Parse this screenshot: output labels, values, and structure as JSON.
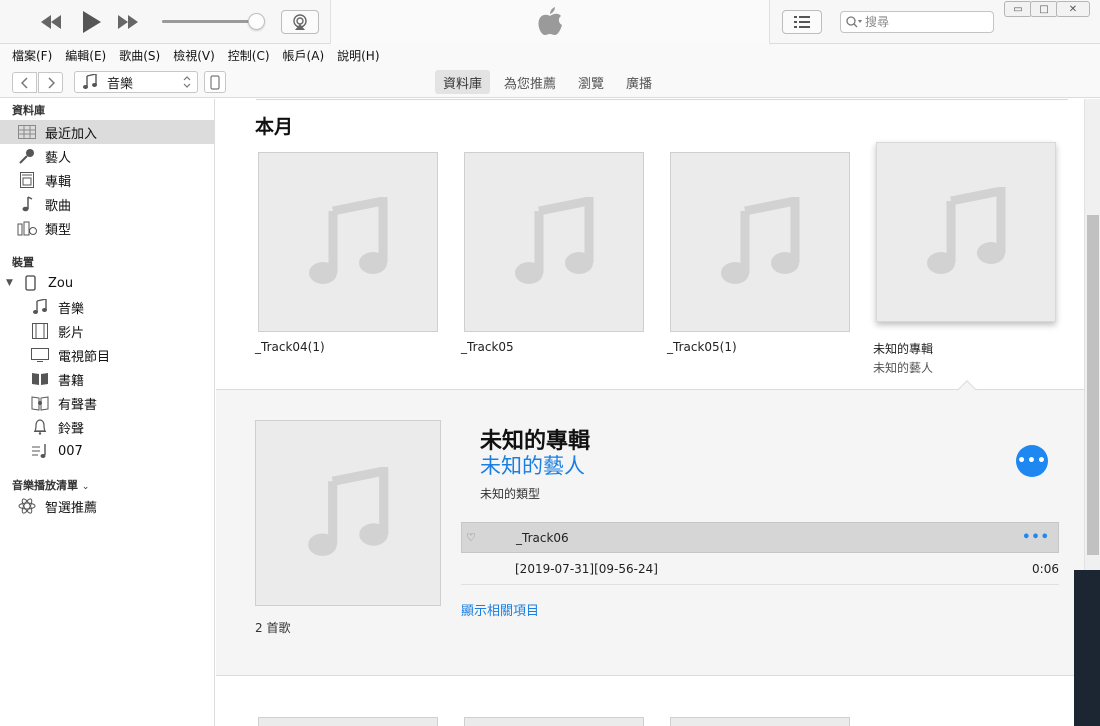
{
  "window": {
    "search_placeholder": "搜尋",
    "minimize_glyph": "▭",
    "restore_glyph": "□",
    "close_glyph": "✕"
  },
  "menu": [
    "檔案(F)",
    "編輯(E)",
    "歌曲(S)",
    "檢視(V)",
    "控制(C)",
    "帳戶(A)",
    "說明(H)"
  ],
  "nav": {
    "media_kind": "音樂",
    "tabs": [
      "資料庫",
      "為您推薦",
      "瀏覽",
      "廣播"
    ],
    "active_tab": "資料庫"
  },
  "sidebar": {
    "library_title": "資料庫",
    "library": [
      {
        "label": "最近加入",
        "icon": "grid-icon",
        "selected": true
      },
      {
        "label": "藝人",
        "icon": "microphone-icon"
      },
      {
        "label": "專輯",
        "icon": "album-icon"
      },
      {
        "label": "歌曲",
        "icon": "note-icon"
      },
      {
        "label": "類型",
        "icon": "genre-icon"
      }
    ],
    "devices_title": "裝置",
    "device_name": "Zou",
    "device_items": [
      {
        "label": "音樂",
        "icon": "music-icon"
      },
      {
        "label": "影片",
        "icon": "film-icon"
      },
      {
        "label": "電視節目",
        "icon": "tv-icon"
      },
      {
        "label": "書籍",
        "icon": "book-icon"
      },
      {
        "label": "有聲書",
        "icon": "audiobook-icon"
      },
      {
        "label": "鈴聲",
        "icon": "bell-icon"
      },
      {
        "label": "007",
        "icon": "playlist-icon"
      }
    ],
    "playlists_title": "音樂播放清單",
    "playlists": [
      {
        "label": "智選推薦",
        "icon": "genius-icon"
      }
    ]
  },
  "main": {
    "section_title": "本月",
    "albums": [
      {
        "title": "_Track04(1)",
        "artist": ""
      },
      {
        "title": "_Track05",
        "artist": ""
      },
      {
        "title": "_Track05(1)",
        "artist": ""
      },
      {
        "title": "未知的專輯",
        "artist": "未知的藝人"
      }
    ],
    "detail": {
      "album": "未知的專輯",
      "artist": "未知的藝人",
      "genre": "未知的類型",
      "tracks": [
        {
          "name": "_Track06",
          "duration": "",
          "selected": true
        },
        {
          "name": "[2019-07-31][09-56-24]",
          "duration": "0:06",
          "selected": false
        }
      ],
      "show_related": "顯示相關項目",
      "song_count": "2 首歌"
    }
  },
  "colors": {
    "accent": "#1e88f0",
    "link": "#1a7fe0",
    "selected_row": "#dcdcdc"
  }
}
